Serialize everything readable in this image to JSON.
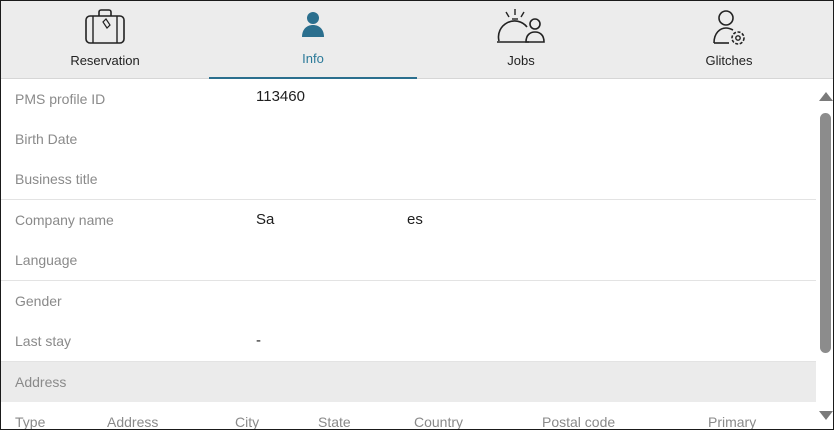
{
  "tabs": [
    {
      "label": "Reservation",
      "icon": "suitcase-icon",
      "active": false
    },
    {
      "label": "Info",
      "icon": "person-icon",
      "active": true
    },
    {
      "label": "Jobs",
      "icon": "cloche-person-icon",
      "active": false
    },
    {
      "label": "Glitches",
      "icon": "user-gear-icon",
      "active": false
    }
  ],
  "fields": [
    {
      "label": "PMS profile ID",
      "value": "113460"
    },
    {
      "label": "Birth Date",
      "value": ""
    },
    {
      "label": "Business title",
      "value": ""
    },
    {
      "label": "Company name",
      "value": "Sa",
      "value_suffix": "es"
    },
    {
      "label": "Language",
      "value": ""
    },
    {
      "label": "Gender",
      "value": ""
    },
    {
      "label": "Last stay",
      "value": "-"
    }
  ],
  "address_section": {
    "title": "Address",
    "columns": [
      "Type",
      "Address",
      "City",
      "State",
      "Country",
      "Postal code",
      "Primary"
    ]
  },
  "colors": {
    "accent": "#2b6f8e",
    "tab_bar": "#ececec",
    "label": "#8a8a8a"
  }
}
